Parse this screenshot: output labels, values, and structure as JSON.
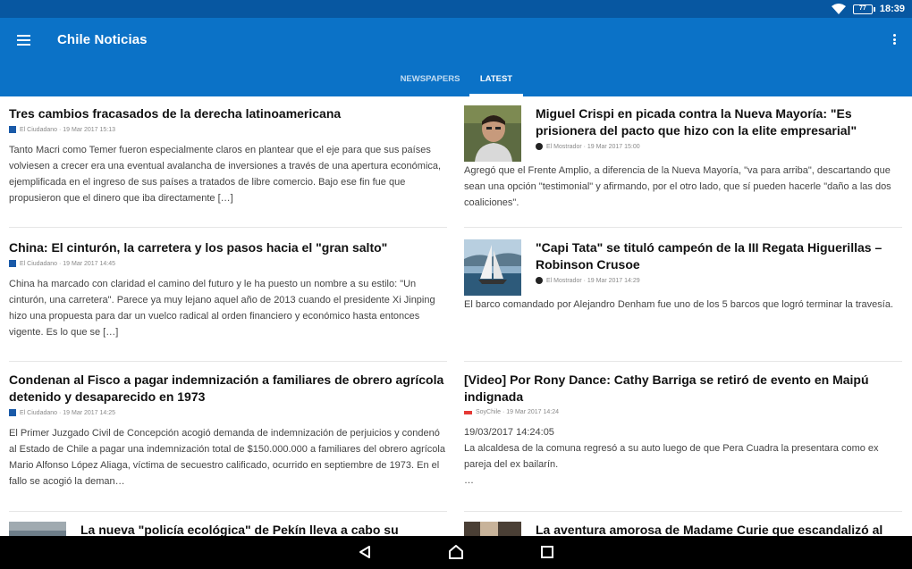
{
  "status": {
    "battery": "77",
    "time": "18:39"
  },
  "app": {
    "title": "Chile Noticias"
  },
  "tabs": [
    {
      "label": "NEWSPAPERS",
      "active": false
    },
    {
      "label": "LATEST",
      "active": true
    }
  ],
  "articles": [
    {
      "title": "Tres cambios fracasados de la derecha latinoamericana",
      "source": "El Ciudadano · 19 Mar 2017 15:13",
      "summary": "Tanto Macri como Temer fueron especialmente claros en plantear que el eje para que sus países volviesen a crecer era una eventual avalancha de inversiones a través de una apertura económica, ejemplificada en el ingreso de sus países a tratados de libre comercio. Bajo ese fin fue que propusieron que el dinero que iba directamente […]"
    },
    {
      "title": "Miguel Crispi en picada contra la Nueva Mayoría: \"Es prisionera del pacto que hizo con la elite empresarial\"",
      "source": "El Mostrador · 19 Mar 2017 15:00",
      "summary": "Agregó que el Frente Amplio, a diferencia de la Nueva Mayoría, \"va para arriba\", descartando que sean una opción \"testimonial\" y afirmando, por el otro lado, que sí pueden hacerle \"daño a las dos coaliciones\"."
    },
    {
      "title": "China: El cinturón, la carretera y los pasos hacia el \"gran salto\"",
      "source": "El Ciudadano · 19 Mar 2017 14:45",
      "summary": "China ha marcado con claridad el camino del futuro y le ha puesto un nombre a su estilo: \"Un cinturón, una carretera\". Parece ya muy lejano aquel año de 2013 cuando el presidente Xi Jinping hizo una propuesta para dar un vuelco radical al orden financiero y económico hasta entonces vigente. Es lo que se […]"
    },
    {
      "title": "\"Capi Tata\" se tituló campeón de la III Regata Higuerillas – Robinson Crusoe",
      "source": "El Mostrador · 19 Mar 2017 14:29",
      "summary": "El barco comandado por Alejandro Denham fue uno de los 5 barcos que logró terminar la travesía."
    },
    {
      "title": "Condenan al Fisco a pagar indemnización a familiares de obrero agrícola detenido y desaparecido en 1973",
      "source": "El Ciudadano · 19 Mar 2017 14:25",
      "summary": "El Primer Juzgado Civil de Concepción acogió demanda de indemnización de perjuicios y condenó al Estado de Chile a pagar una indemnización total de $150.000.000 a familiares del obrero agrícola Mario Alfonso López Aliaga, víctima de secuestro calificado, ocurrido en septiembre de 1973. En el fallo se acogió la deman…"
    },
    {
      "title": "[Video] Por Rony Dance: Cathy Barriga se retiró de evento en Maipú indignada",
      "source": "SoyChile · 19 Mar 2017 14:24",
      "summary": "19/03/2017 14:24:05\nLa alcaldesa de la comuna regresó a su auto luego de que Pera Cuadra la presentara como ex pareja del ex bailarín.\n…"
    },
    {
      "title": "La nueva \"policía ecológica\" de Pekín lleva a cabo su"
    },
    {
      "title": "La aventura amorosa de Madame Curie que escandalizó al"
    }
  ],
  "nav": {
    "back": "back-icon",
    "home": "home-icon",
    "recents": "recents-icon"
  }
}
